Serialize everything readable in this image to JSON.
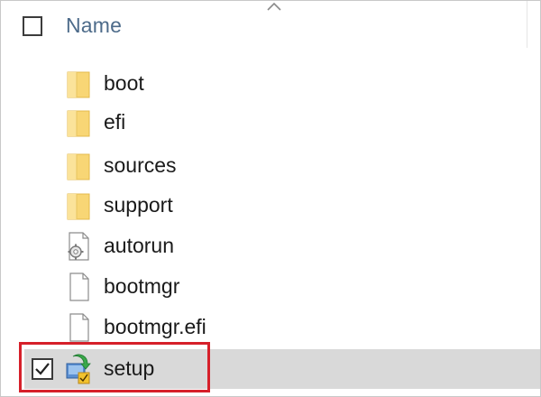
{
  "header": {
    "column_name": "Name"
  },
  "files": [
    {
      "name": "boot",
      "icon": "folder-icon",
      "selected": false
    },
    {
      "name": "efi",
      "icon": "folder-icon",
      "selected": false
    },
    {
      "name": "sources",
      "icon": "folder-icon",
      "selected": false
    },
    {
      "name": "support",
      "icon": "folder-icon",
      "selected": false
    },
    {
      "name": "autorun",
      "icon": "settings-file-icon",
      "selected": false
    },
    {
      "name": "bootmgr",
      "icon": "blank-file-icon",
      "selected": false
    },
    {
      "name": "bootmgr.efi",
      "icon": "blank-file-icon",
      "selected": false
    },
    {
      "name": "setup",
      "icon": "setup-app-icon",
      "selected": true
    }
  ],
  "colors": {
    "folder": "#f8d675",
    "selection": "#d9d9d9",
    "highlight": "#d6202a",
    "header_text": "#4d6b8a"
  }
}
